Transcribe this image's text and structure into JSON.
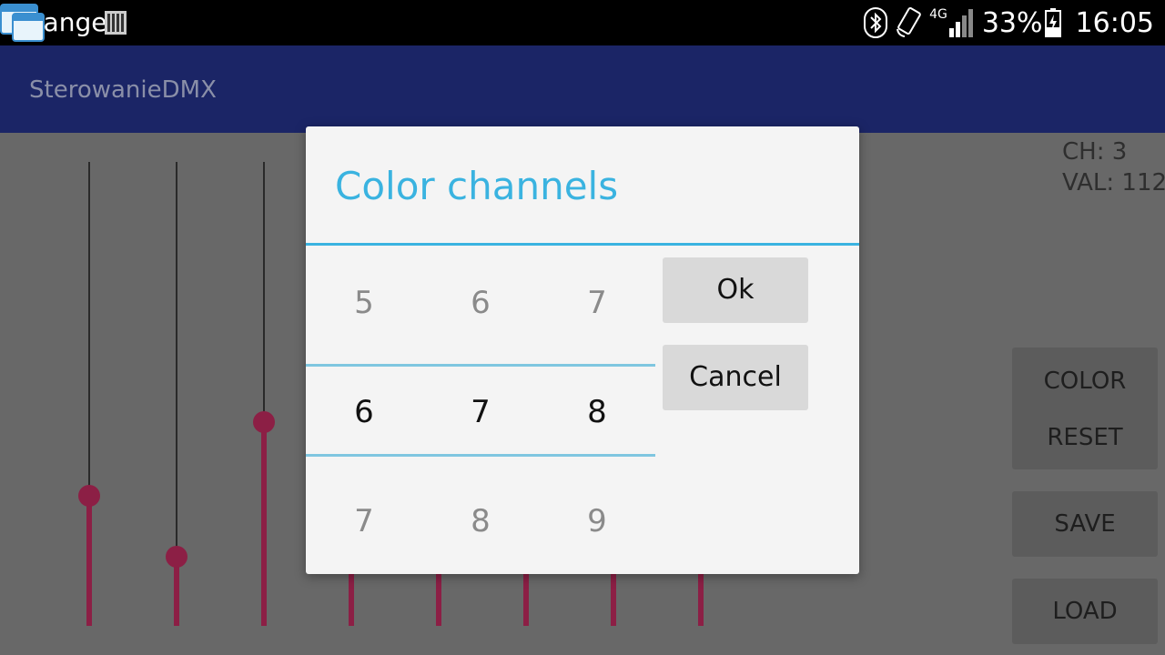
{
  "status_bar": {
    "carrier": "Orange",
    "network_type": "4G",
    "battery_percent": "33%",
    "time": "16:05",
    "icons": [
      "app-notification-icon",
      "sim-icon",
      "bluetooth-icon",
      "rotation-lock-icon",
      "signal-icon",
      "battery-charging-icon"
    ]
  },
  "action_bar": {
    "title": "SterowanieDMX"
  },
  "channel_info": {
    "text": "CH: 3\nVAL: 112"
  },
  "side_buttons": {
    "color_reset_line1": "COLOR",
    "color_reset_line2": "RESET",
    "save": "SAVE",
    "load": "LOAD"
  },
  "sliders": [
    {
      "level": 0.28
    },
    {
      "level": 0.15
    },
    {
      "level": 0.44
    },
    {
      "level": null
    },
    {
      "level": null
    },
    {
      "level": null
    },
    {
      "level": null
    },
    {
      "level": null
    }
  ],
  "accent_color": "#3ab3e0",
  "slider_color": "#8c1f45",
  "dialog": {
    "title": "Color channels",
    "pickers": [
      {
        "prev": "5",
        "current": "6",
        "next": "7"
      },
      {
        "prev": "6",
        "current": "7",
        "next": "8"
      },
      {
        "prev": "7",
        "current": "8",
        "next": "9"
      }
    ],
    "ok_label": "Ok",
    "cancel_label": "Cancel"
  }
}
